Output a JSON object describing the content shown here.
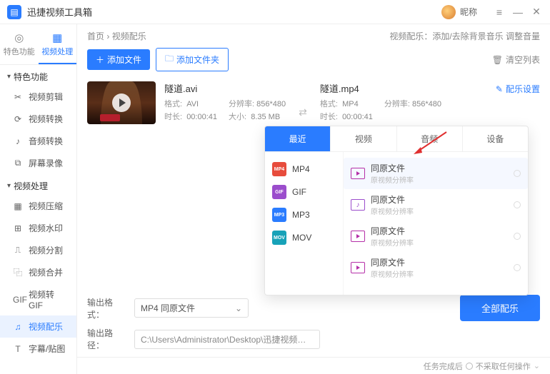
{
  "app": {
    "title": "迅捷视频工具箱",
    "nickname": "昵称"
  },
  "rail_tabs": {
    "special": "特色功能",
    "process": "视频处理"
  },
  "rail": {
    "section_special": "特色功能",
    "special_items": [
      {
        "icon": "✂",
        "label": "视频剪辑"
      },
      {
        "icon": "⟳",
        "label": "视频转换"
      },
      {
        "icon": "♪",
        "label": "音频转换"
      },
      {
        "icon": "⧉",
        "label": "屏幕录像"
      }
    ],
    "section_process": "视频处理",
    "process_items": [
      {
        "icon": "▦",
        "label": "视频压缩"
      },
      {
        "icon": "⊞",
        "label": "视频水印"
      },
      {
        "icon": "⎍",
        "label": "视频分割"
      },
      {
        "icon": "⿻",
        "label": "视频合并"
      },
      {
        "icon": "GIF",
        "label": "视频转GIF"
      },
      {
        "icon": "♫",
        "label": "视频配乐",
        "active": true
      },
      {
        "icon": "T",
        "label": "字幕/贴图"
      }
    ]
  },
  "breadcrumb": {
    "home": "首页",
    "current": "视频配乐"
  },
  "header_desc": "视频配乐：添加/去除背景音乐 调整音量",
  "toolbar": {
    "add_file": "添加文件",
    "add_folder": "添加文件夹",
    "clear": "清空列表"
  },
  "file": {
    "src_name": "隧道.avi",
    "src_format_label": "格式:",
    "src_format": "AVI",
    "src_res_label": "分辨率:",
    "src_res": "856*480",
    "src_dur_label": "时长:",
    "src_dur": "00:00:41",
    "src_size_label": "大小:",
    "src_size": "8.35 MB",
    "out_name": "隧道.mp4",
    "out_format_label": "格式:",
    "out_format": "MP4",
    "out_res_label": "分辨率:",
    "out_res": "856*480",
    "out_dur_label": "时长:",
    "out_dur": "00:00:41",
    "select_label": "MP4 同原文件",
    "settings": "配乐设置"
  },
  "popup": {
    "tabs": {
      "recent": "最近",
      "video": "视频",
      "audio": "音频",
      "device": "设备"
    },
    "left": [
      {
        "badge": "MP4",
        "cls": "red",
        "name": "MP4"
      },
      {
        "badge": "GIF",
        "cls": "purple",
        "name": "GIF"
      },
      {
        "badge": "MP3",
        "cls": "blue",
        "name": "MP3"
      },
      {
        "badge": "MOV",
        "cls": "teal",
        "name": "MOV"
      }
    ],
    "right": [
      {
        "title": "同原文件",
        "sub": "原视频分辨率",
        "active": true
      },
      {
        "title": "同原文件",
        "sub": "原视频分辨率",
        "audio": true
      },
      {
        "title": "同原文件",
        "sub": "原视频分辨率"
      },
      {
        "title": "同原文件",
        "sub": "原视频分辨率"
      }
    ]
  },
  "bottom": {
    "out_format_label": "输出格式：",
    "out_format_value": "MP4 同原文件",
    "out_path_label": "输出路径：",
    "out_path_value": "C:\\Users\\Administrator\\Desktop\\迅捷视频工具",
    "action": "全部配乐",
    "status_label": "任务完成后",
    "status_value": "不采取任何操作"
  }
}
